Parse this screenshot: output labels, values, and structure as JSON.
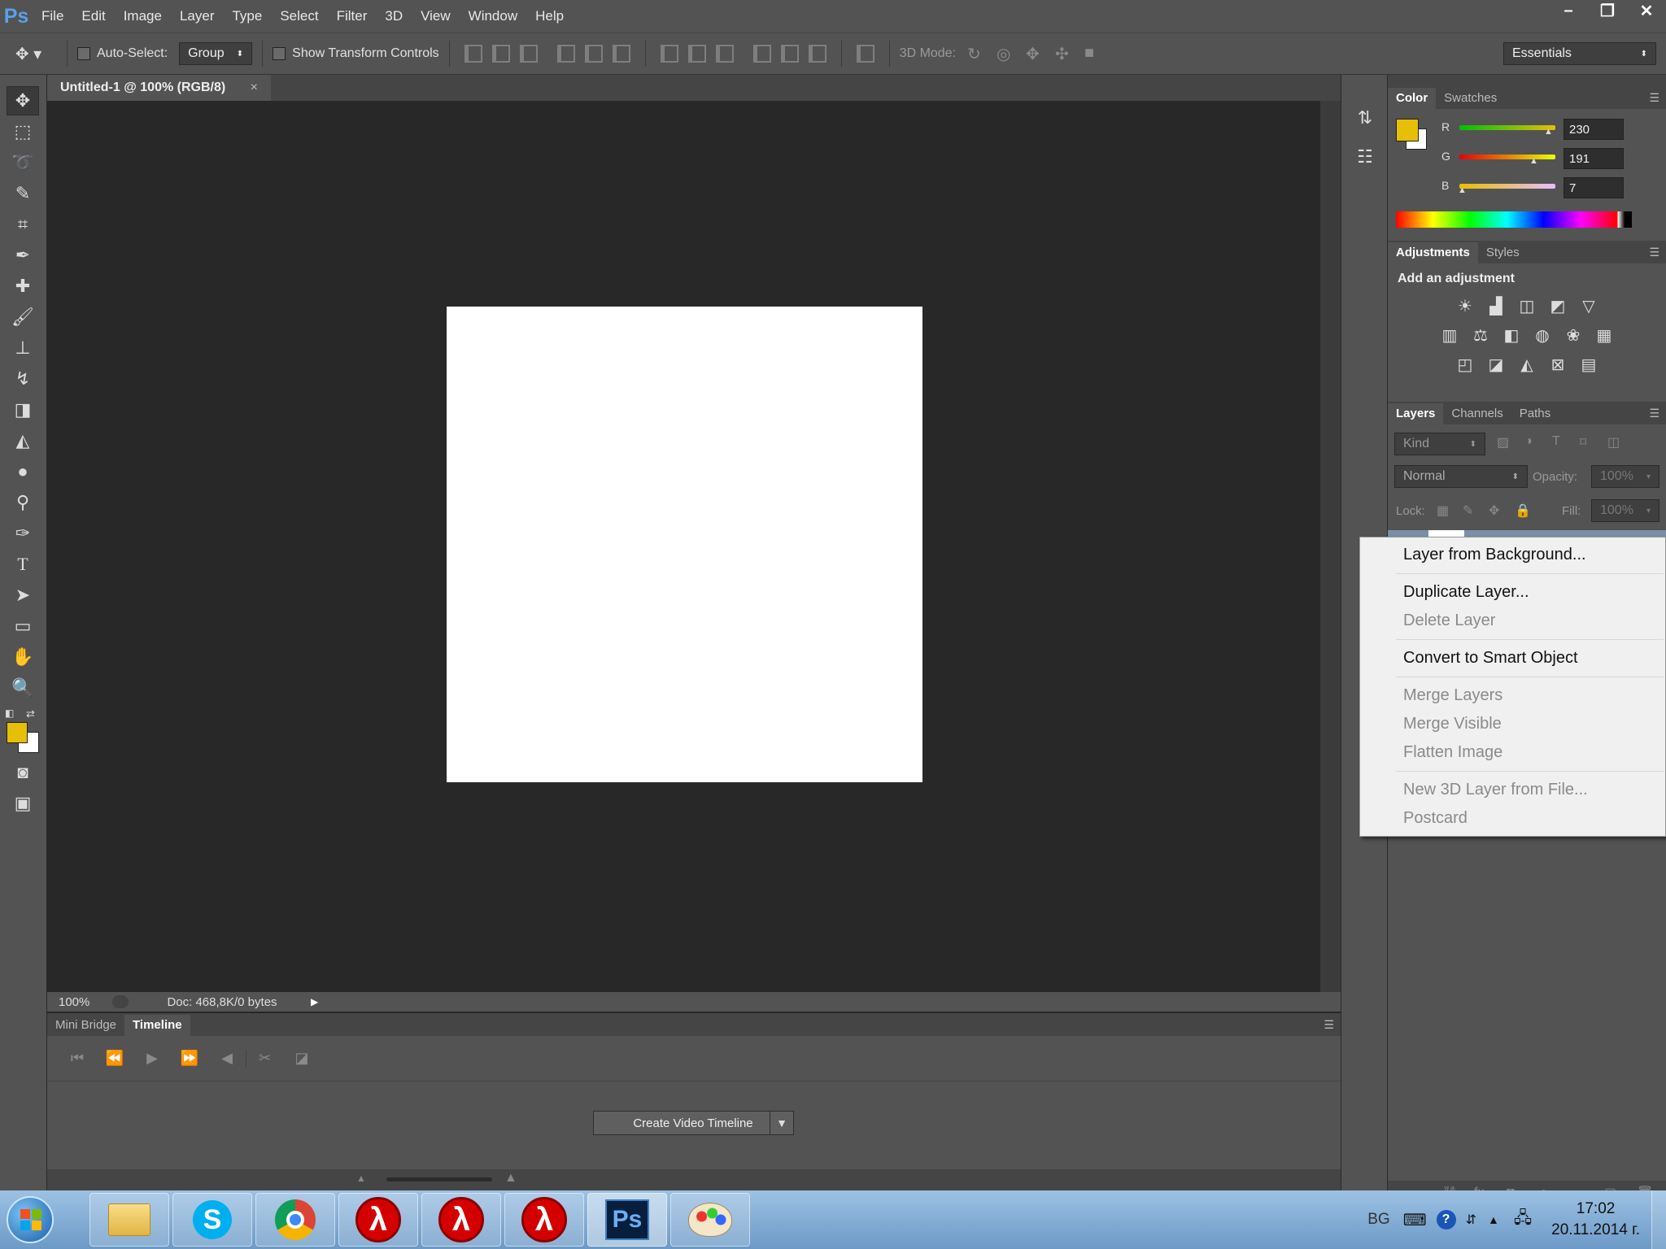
{
  "app": {
    "logo": "Ps"
  },
  "menu": [
    "File",
    "Edit",
    "Image",
    "Layer",
    "Type",
    "Select",
    "Filter",
    "3D",
    "View",
    "Window",
    "Help"
  ],
  "window_controls": {
    "minimize": "–",
    "restore": "❐",
    "close": "✕"
  },
  "options_bar": {
    "auto_select_label": "Auto-Select:",
    "auto_select_value": "Group",
    "show_transform_label": "Show Transform Controls",
    "mode_3d_label": "3D Mode:",
    "workspace": "Essentials"
  },
  "document": {
    "tab_title": "Untitled-1 @ 100% (RGB/8)",
    "tab_close": "×",
    "zoom": "100%",
    "doc_info": "Doc: 468,8K/0 bytes"
  },
  "timeline": {
    "tabs": [
      "Mini Bridge",
      "Timeline"
    ],
    "create_button": "Create Video Timeline"
  },
  "color_panel": {
    "tabs": [
      "Color",
      "Swatches"
    ],
    "channels": [
      {
        "label": "R",
        "value": "230"
      },
      {
        "label": "G",
        "value": "191"
      },
      {
        "label": "B",
        "value": "7"
      }
    ],
    "foreground": "#e6bf07",
    "background": "#ffffff"
  },
  "adjustments_panel": {
    "tabs": [
      "Adjustments",
      "Styles"
    ],
    "heading": "Add an adjustment"
  },
  "layers_panel": {
    "tabs": [
      "Layers",
      "Channels",
      "Paths"
    ],
    "kind_filter": "Kind",
    "blend_mode": "Normal",
    "opacity_label": "Opacity:",
    "opacity_value": "100%",
    "lock_label": "Lock:",
    "fill_label": "Fill:",
    "fill_value": "100%"
  },
  "context_menu": {
    "items": [
      {
        "label": "Layer from Background...",
        "enabled": true
      },
      {
        "label": "Duplicate Layer...",
        "enabled": true
      },
      {
        "label": "Delete Layer",
        "enabled": false
      },
      {
        "label": "Convert to Smart Object",
        "enabled": true
      },
      {
        "label": "Merge Layers",
        "enabled": false
      },
      {
        "label": "Merge Visible",
        "enabled": false
      },
      {
        "label": "Flatten Image",
        "enabled": false
      },
      {
        "label": "New 3D Layer from File...",
        "enabled": false
      },
      {
        "label": "Postcard",
        "enabled": false
      }
    ]
  },
  "taskbar": {
    "language": "BG",
    "time": "17:02",
    "date": "20.11.2014 г.",
    "apps": [
      "explorer",
      "skype",
      "chrome",
      "half-life",
      "half-life",
      "half-life",
      "photoshop",
      "paint"
    ],
    "ps_label": "Ps",
    "lambda": "λ"
  }
}
